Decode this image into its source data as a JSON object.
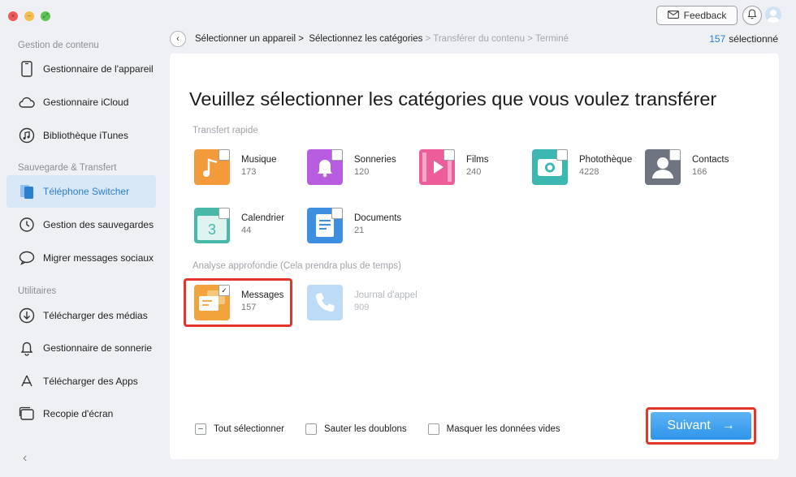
{
  "window": {
    "controls": [
      "close",
      "minimize",
      "fullscreen"
    ]
  },
  "topbar": {
    "feedback_label": "Feedback",
    "icons": [
      "mail-icon",
      "bell-icon",
      "avatar-icon"
    ]
  },
  "sidebar": {
    "sections": [
      {
        "title": "Gestion de contenu",
        "items": [
          {
            "label": "Gestionnaire de l'appareil",
            "icon": "phone-outline-icon"
          },
          {
            "label": "Gestionnaire iCloud",
            "icon": "cloud-icon"
          },
          {
            "label": "Bibliothèque iTunes",
            "icon": "music-note-icon"
          }
        ]
      },
      {
        "title": "Sauvegarde & Transfert",
        "items": [
          {
            "label": "Téléphone Switcher",
            "icon": "phone-switch-icon",
            "active": true
          },
          {
            "label": "Gestion des sauvegardes",
            "icon": "history-icon"
          },
          {
            "label": "Migrer messages sociaux",
            "icon": "chat-icon"
          }
        ]
      },
      {
        "title": "Utilitaires",
        "items": [
          {
            "label": "Télécharger des médias",
            "icon": "download-icon"
          },
          {
            "label": "Gestionnaire de sonnerie",
            "icon": "bell-icon"
          },
          {
            "label": "Télécharger des Apps",
            "icon": "app-store-icon"
          },
          {
            "label": "Recopie d'écran",
            "icon": "screen-mirror-icon"
          }
        ]
      }
    ],
    "collapse_icon": "chevron-left-icon"
  },
  "breadcrumb": {
    "steps": [
      {
        "label": "Sélectionner un appareil >",
        "state": "done"
      },
      {
        "label": "Sélectionnez les catégories",
        "state": "current"
      },
      {
        "label": "> Transférer du contenu >",
        "state": "pending"
      },
      {
        "label": "Terminé",
        "state": "pending"
      }
    ]
  },
  "selection": {
    "count": "157",
    "label": "sélectionné"
  },
  "main": {
    "heading": "Veuillez sélectionner les catégories que vous voulez transférer",
    "quick_transfer_label": "Transfert rapide",
    "deep_analysis_label": "Analyse approfondie (Cela prendra plus de temps)",
    "quick_categories": [
      {
        "name": "Musique",
        "count": "173",
        "icon": "music-icon",
        "color": "#f39a3a",
        "checked": false
      },
      {
        "name": "Sonneries",
        "count": "120",
        "icon": "bell-icon",
        "color": "#b95de0",
        "checked": false
      },
      {
        "name": "Films",
        "count": "240",
        "icon": "film-icon",
        "color": "#ec5d9a",
        "checked": false
      },
      {
        "name": "Photothèque",
        "count": "4228",
        "icon": "camera-icon",
        "color": "#3cb7b1",
        "checked": false
      },
      {
        "name": "Contacts",
        "count": "166",
        "icon": "contact-icon",
        "color": "#6e7480",
        "checked": false
      },
      {
        "name": "Calendrier",
        "count": "44",
        "icon": "calendar-icon",
        "color": "#48b8a8",
        "checked": false
      },
      {
        "name": "Documents",
        "count": "21",
        "icon": "document-icon",
        "color": "#3f8fe0",
        "checked": false
      }
    ],
    "deep_categories": [
      {
        "name": "Messages",
        "count": "157",
        "icon": "message-icon",
        "color": "#f2a33b",
        "checked": true,
        "enabled": true
      },
      {
        "name": "Journal d'appel",
        "count": "909",
        "icon": "phone-call-icon",
        "color": "#9cc8f0",
        "checked": false,
        "enabled": false
      }
    ]
  },
  "footer": {
    "options": [
      {
        "label": "Tout sélectionner",
        "state": "partial"
      },
      {
        "label": "Sauter les doublons",
        "state": "unchecked"
      },
      {
        "label": "Masquer les données vides",
        "state": "unchecked"
      }
    ],
    "next_label": "Suivant",
    "next_icon": "arrow-right-icon"
  },
  "colors": {
    "accent": "#2a7fcf",
    "highlight": "#e2352c",
    "button": "#3a9cee"
  }
}
